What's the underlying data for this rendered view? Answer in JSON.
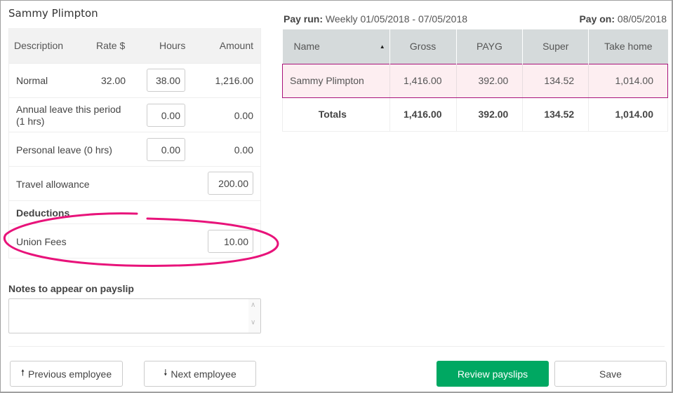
{
  "employee": {
    "name": "Sammy Plimpton"
  },
  "earnings_table": {
    "headers": {
      "description": "Description",
      "rate": "Rate $",
      "hours": "Hours",
      "amount": "Amount"
    },
    "rows": [
      {
        "description": "Normal",
        "rate": "32.00",
        "hours": "38.00",
        "amount": "1,216.00"
      },
      {
        "description": "Annual leave this period",
        "description_line2": "(1 hrs)",
        "hours": "0.00",
        "amount": "0.00"
      },
      {
        "description": "Personal leave (0 hrs)",
        "hours": "0.00",
        "amount": "0.00"
      },
      {
        "description": "Travel allowance",
        "amount_input": "200.00"
      }
    ],
    "deductions_label": "Deductions",
    "deductions": [
      {
        "description": "Union Fees",
        "amount_input": "10.00"
      }
    ]
  },
  "notes": {
    "label": "Notes to appear on payslip",
    "value": ""
  },
  "pay_run": {
    "label": "Pay run:",
    "value": "Weekly 01/05/2018 - 07/05/2018",
    "pay_on_label": "Pay on:",
    "pay_on_value": "08/05/2018"
  },
  "summary_table": {
    "headers": [
      "Name",
      "Gross",
      "PAYG",
      "Super",
      "Take home"
    ],
    "rows": [
      {
        "name": "Sammy Plimpton",
        "gross": "1,416.00",
        "payg": "392.00",
        "super": "134.52",
        "take_home": "1,014.00"
      }
    ],
    "totals": {
      "label": "Totals",
      "gross": "1,416.00",
      "payg": "392.00",
      "super": "134.52",
      "take_home": "1,014.00"
    }
  },
  "buttons": {
    "previous": "Previous employee",
    "next": "Next employee",
    "review": "Review payslips",
    "save": "Save"
  },
  "icons": {
    "sort": "sort-asc-icon",
    "up": "arrow-up-icon",
    "down": "arrow-down-icon"
  },
  "colors": {
    "primary": "#00a862",
    "selected_row_border": "#a8137a",
    "selected_row_bg": "#fdeef1",
    "annotation": "#e8137a"
  }
}
